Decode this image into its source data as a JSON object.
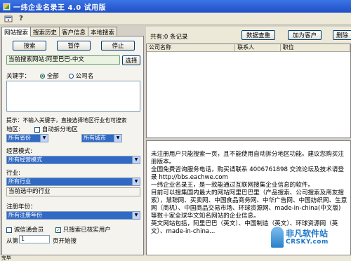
{
  "window": {
    "title": "一纬企业名录王 4.0  试用版"
  },
  "toolbar": {
    "icons": [
      "app-menu-icon",
      "help-icon"
    ],
    "help_glyph": "?"
  },
  "tabs": [
    "网站搜索",
    "搜索历史",
    "客户信息",
    "本地搜索"
  ],
  "left": {
    "btn_search": "搜索",
    "btn_pause": "暂停",
    "btn_stop": "停止",
    "current_site": "当前搜索网站:阿里巴巴-中文",
    "btn_choose": "选择",
    "keyword_label": "关键字：",
    "radio_all": "全部",
    "radio_company": "公司名",
    "hint": "提示：不输入关键字，直接选择地区行业也可搜索",
    "region_label": "地区:",
    "auto_split": "自动拆分地区",
    "province": "所有省份",
    "city": "所有城市",
    "mode_label": "经营模式:",
    "mode_value": "所有经营模式",
    "industry_label": "行业:",
    "industry_value": "所有行业",
    "current_industry_label": "当前选中的行业",
    "year_label": "注册年份：",
    "year_value": "所有注册年份",
    "chk_trust": "诚信通会员",
    "chk_real": "只搜索已核实用户",
    "from_label": "从第",
    "from_value": "1",
    "from_suffix": "页开始搜"
  },
  "right": {
    "count_text": "共有:0 条记录",
    "btn_dedupe": "数据查重",
    "btn_add": "加为客户",
    "btn_delete": "删除",
    "columns": [
      "公司名称",
      "联系人",
      "职位"
    ],
    "info_lines": [
      "未注册用户只能搜索一页，且不能使用自动拆分地区功能。建议您购买注册版本。",
      "",
      "全国免费咨询服务电话，购买请联系 4006761898 交流论坛及技术请登录 http://bbs.eachwe.com",
      "一纬企业名录王，是一款能通过互联网搜集企业信息的软件。",
      "目前可以搜集国内最大的网站阿里巴巴里（产品搜索、公司搜索及商友搜索），慧聪网、买卖网、中国食品商务网、中华广告网、中国纺织网、生意网（商机）、中国商品交易市场、环球资源网、made-in-china(中文版) 等数十家全球华文知名网站的企业信息。",
      "英文网站包括，阿里巴巴（英文）、中国制造（英文）、环球资源网（英文）、made-in-china..."
    ]
  },
  "status": "完毕",
  "watermark": {
    "line1": "非凡软件站",
    "line2": "CRSKY.com"
  },
  "colors": {
    "title_bar": "#245edb",
    "selected_select": "#316ac5",
    "watermark": "#1a75c9"
  }
}
